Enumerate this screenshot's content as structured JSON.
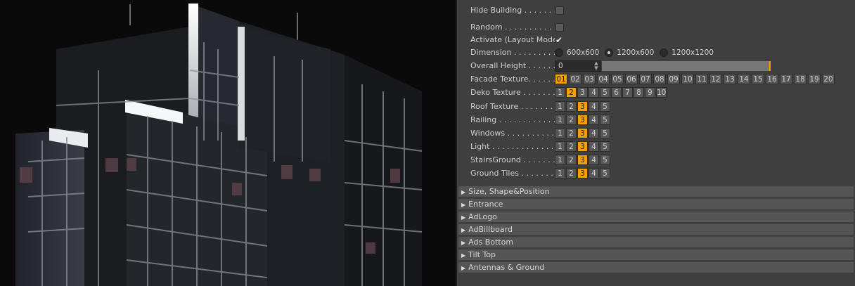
{
  "colors": {
    "accent": "#f5a000",
    "panel_bg": "#3f3f3f",
    "section_bg": "#555555",
    "button_bg": "#575757"
  },
  "hide_building": {
    "label": "Hide Building . . . . . . . .",
    "checked": false
  },
  "random": {
    "label": "Random . . . . . . . . . . . . .",
    "checked": false
  },
  "activate": {
    "label": "Activate (Layout Mode)",
    "checked": true
  },
  "dimension": {
    "label": "Dimension . . . . . . . . . . .",
    "options": [
      "600x600",
      "1200x600",
      "1200x1200"
    ],
    "selected": "1200x600"
  },
  "overall_height": {
    "label": "Overall Height . . . . . . .",
    "value": "0",
    "slider_fraction": 1.0
  },
  "facade_texture": {
    "label": "Facade Texture. . . . . . . .",
    "options": [
      "01",
      "02",
      "03",
      "04",
      "05",
      "06",
      "07",
      "08",
      "09",
      "10",
      "11",
      "12",
      "13",
      "14",
      "15",
      "16",
      "17",
      "18",
      "19",
      "20"
    ],
    "selected": "01"
  },
  "deko_texture": {
    "label": "Deko Texture . . . . . . . .",
    "options": [
      "1",
      "2",
      "3",
      "4",
      "5",
      "6",
      "7",
      "8",
      "9",
      "10"
    ],
    "selected": "2"
  },
  "pickers": [
    {
      "label": "Roof Texture . . . . . . . . .",
      "options": [
        "1",
        "2",
        "3",
        "4",
        "5"
      ],
      "selected": "3"
    },
    {
      "label": "Railing . . . . . . . . . . . . . .",
      "options": [
        "1",
        "2",
        "3",
        "4",
        "5"
      ],
      "selected": "3"
    },
    {
      "label": "Windows . . . . . . . . . . . .",
      "options": [
        "1",
        "2",
        "3",
        "4",
        "5"
      ],
      "selected": "3"
    },
    {
      "label": "Light . . . . . . . . . . . . . . .",
      "options": [
        "1",
        "2",
        "3",
        "4",
        "5"
      ],
      "selected": "3"
    },
    {
      "label": "StairsGround . . . . . . . . .",
      "options": [
        "1",
        "2",
        "3",
        "4",
        "5"
      ],
      "selected": "3"
    },
    {
      "label": "Ground Tiles . . . . . . . . .",
      "options": [
        "1",
        "2",
        "3",
        "4",
        "5"
      ],
      "selected": "3"
    }
  ],
  "sections": [
    "Size, Shape&Position",
    "Entrance",
    "AdLogo",
    "AdBillboard",
    "Ads Bottom",
    "Tilt Top",
    "Antennas & Ground"
  ],
  "icons": {
    "section_toggle": "triangle-right-icon",
    "checked": "checkmark-icon"
  }
}
